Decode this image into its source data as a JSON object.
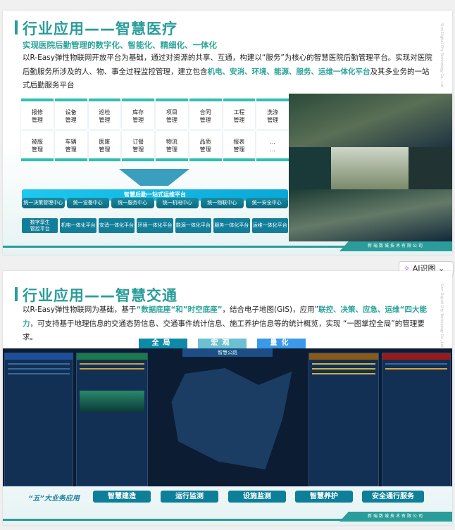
{
  "slide1": {
    "title": "行业应用——智慧医疗",
    "subtitle": "实现医院后勤管理的数字化、智能化、精细化、一体化",
    "body_a": "以R-Easy弹性物联网开放平台为基础，通过对资源的共享、互通，构建以“服务”为核心的智慧医院后勤管理平台。实现对医院后勤服务所涉及的人、物、事全过程监控管理，建立包含",
    "body_hl": "机电、安消、环境、能源、服务、运维一体化平台",
    "body_b": "及其多业务的一站式后勤服务平台",
    "modules": [
      "报修\n管理",
      "设备\n管理",
      "巡检\n管理",
      "库存\n管理",
      "项目\n管理",
      "合同\n管理",
      "工程\n管理",
      "洗涤\n管理",
      "被服\n管理",
      "车辆\n管理",
      "医废\n管理",
      "订餐\n管理",
      "物流\n管理",
      "品质\n管理",
      "报表\n管理",
      "...\n..."
    ],
    "platform_bar": "智慧后勤一站式运维平台",
    "centers": [
      "统一决策管理中心",
      "统一设备中心",
      "统一服务中心",
      "统一机电中心",
      "统一物联中心",
      "统一安全中心"
    ],
    "platforms": [
      "数字孪生\n管控平台",
      "机电一体化平台",
      "安消一体化平台",
      "环境一体化平台",
      "能源一体化平台",
      "服务一体化平台",
      "运维一体化平台"
    ]
  },
  "slide2": {
    "title": "行业应用——智慧交通",
    "body_1": "以R-Easy弹性物联网为基础，基于",
    "body_hl1": "“数据底座“和”时空底座”",
    "body_2": "，结合电子地图(GIS)，应用”",
    "body_hl2": "联控、决策、应急、运维“四大能力",
    "body_3": "，可支持基于地理信息的交通态势信息、交通事件统计信息、施工养护信息等的统计概览，实现 “一图掌控全局”的管理要求。",
    "top_buttons": [
      "全局",
      "宏观",
      "量化"
    ],
    "dashboard_title": "智慧公路",
    "five_label": "“五”大业务应用",
    "business": [
      "智慧建造",
      "运行监测",
      "设施监测",
      "智慧养护",
      "安全通行服务"
    ]
  },
  "company": "新瑞数城技术有限公司",
  "watermark": "Sinri Digital City Technology Co., Ltd",
  "ai_button": "AI识图",
  "colors": {
    "accent": "#2a9d9a",
    "button": "#0d7f99",
    "dashboard_bg": "#0d1f2e"
  }
}
